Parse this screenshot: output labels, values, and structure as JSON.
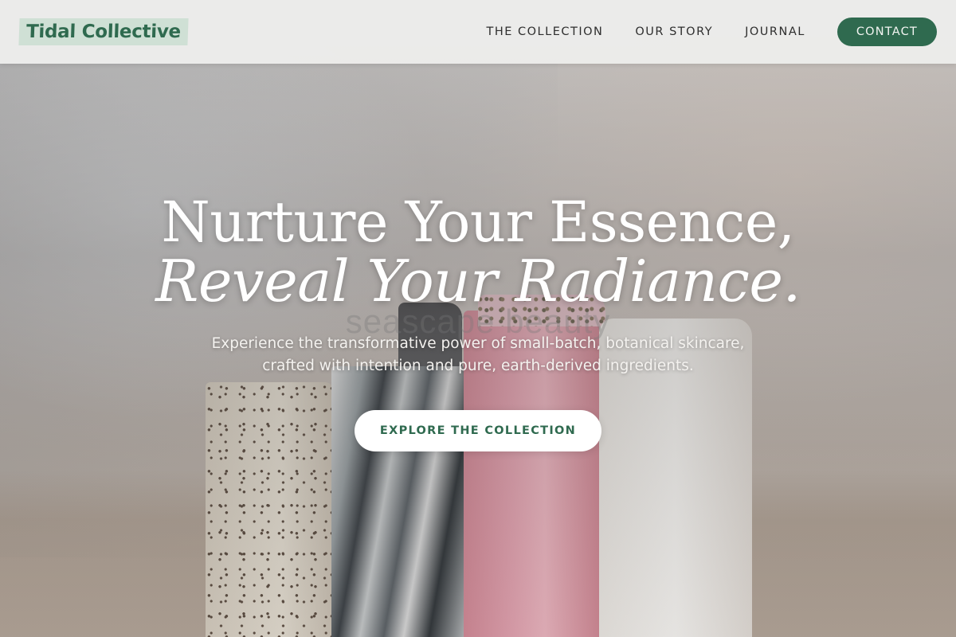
{
  "brand": {
    "name": "Tidal Collective",
    "accent_color": "#2f6a4f",
    "logo_highlight_color": "#cfe0d5"
  },
  "nav": {
    "links": [
      {
        "label": "THE COLLECTION"
      },
      {
        "label": "OUR STORY"
      },
      {
        "label": "JOURNAL"
      }
    ],
    "contact_label": "CONTACT"
  },
  "hero": {
    "headline_line1": "Nurture Your Essence,",
    "headline_line2": "Reveal Your Radiance.",
    "subtext": "Experience the transformative power of small-batch, botanical skincare, crafted with intention and pure, earth-derived ingredients.",
    "cta_label": "EXPLORE THE COLLECTION",
    "background_image": "handmade soap bars (speckled, charcoal swirl, pink, white) against a stone wall",
    "watermark_text": "seascape beauty"
  }
}
